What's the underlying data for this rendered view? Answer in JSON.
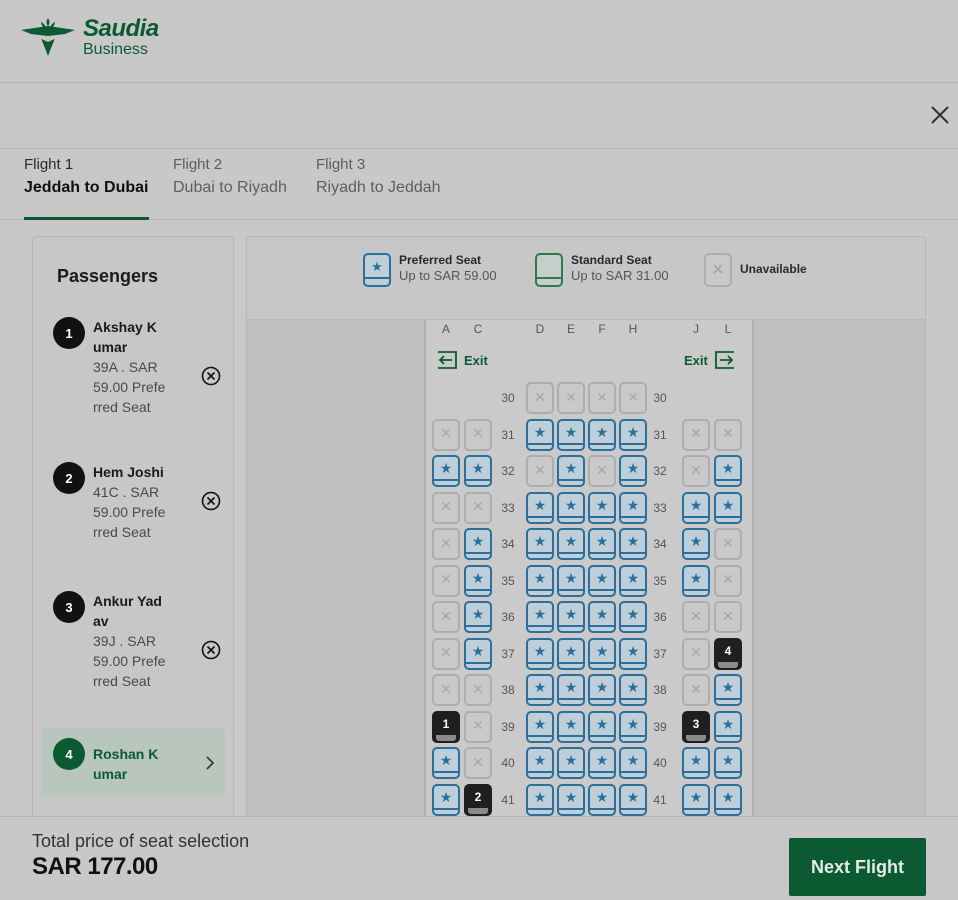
{
  "brand": {
    "name": "Saudia",
    "sub": "Business"
  },
  "tabs": [
    {
      "label": "Flight 1",
      "route": "Jeddah to Dubai",
      "active": true
    },
    {
      "label": "Flight 2",
      "route": "Dubai to Riyadh",
      "active": false
    },
    {
      "label": "Flight 3",
      "route": "Riyadh to Jeddah",
      "active": false
    }
  ],
  "passengers": {
    "title": "Passengers",
    "list": [
      {
        "num": "1",
        "name": "Akshay K umar",
        "info": "39A . SAR 59.00 Preferred Seat"
      },
      {
        "num": "2",
        "name": "Hem Joshi",
        "info": "41C . SAR 59.00 Preferred Seat"
      },
      {
        "num": "3",
        "name": "Ankur Yad av",
        "info": "39J . SAR 59.00 Preferred Seat"
      },
      {
        "num": "4",
        "name": "Roshan K umar",
        "current": true
      }
    ]
  },
  "legend": {
    "preferred": {
      "title": "Preferred Seat",
      "sub": "Up to SAR 59.00"
    },
    "standard": {
      "title": "Standard Seat",
      "sub": "Up to SAR 31.00"
    },
    "unavailable": {
      "title": "Unavailable"
    }
  },
  "seatmap": {
    "columns": [
      "A",
      "C",
      "D",
      "E",
      "F",
      "H",
      "J",
      "L"
    ],
    "exit_left": "Exit",
    "exit_right": "Exit",
    "rows": [
      {
        "num": "30",
        "seats": [
          null,
          null,
          "na",
          "na",
          "na",
          "na",
          null,
          null
        ]
      },
      {
        "num": "31",
        "seats": [
          "na",
          "na",
          "pref",
          "pref",
          "pref",
          "pref",
          "na",
          "na"
        ]
      },
      {
        "num": "32",
        "seats": [
          "pref",
          "pref",
          "na",
          "pref",
          "na",
          "pref",
          "na",
          "pref"
        ]
      },
      {
        "num": "33",
        "seats": [
          "na",
          "na",
          "pref",
          "pref",
          "pref",
          "pref",
          "pref",
          "pref"
        ]
      },
      {
        "num": "34",
        "seats": [
          "na",
          "pref",
          "pref",
          "pref",
          "pref",
          "pref",
          "pref",
          "na"
        ]
      },
      {
        "num": "35",
        "seats": [
          "na",
          "pref",
          "pref",
          "pref",
          "pref",
          "pref",
          "pref",
          "na"
        ]
      },
      {
        "num": "36",
        "seats": [
          "na",
          "pref",
          "pref",
          "pref",
          "pref",
          "pref",
          "na",
          "na"
        ]
      },
      {
        "num": "37",
        "seats": [
          "na",
          "pref",
          "pref",
          "pref",
          "pref",
          "pref",
          "na",
          "4"
        ]
      },
      {
        "num": "38",
        "seats": [
          "na",
          "na",
          "pref",
          "pref",
          "pref",
          "pref",
          "na",
          "pref"
        ]
      },
      {
        "num": "39",
        "seats": [
          "1",
          "na",
          "pref",
          "pref",
          "pref",
          "pref",
          "3",
          "pref"
        ]
      },
      {
        "num": "40",
        "seats": [
          "pref",
          "na",
          "pref",
          "pref",
          "pref",
          "pref",
          "pref",
          "pref"
        ]
      },
      {
        "num": "41",
        "seats": [
          "pref",
          "2",
          "pref",
          "pref",
          "pref",
          "pref",
          "pref",
          "pref"
        ]
      }
    ]
  },
  "footer": {
    "total_label": "Total price of seat selection",
    "total_value": "SAR 177.00",
    "next_label": "Next Flight"
  },
  "colors": {
    "brand_green": "#0c5a32",
    "preferred_blue": "#2b6f9a",
    "overlay_gray": "#c8c8c8"
  },
  "icons": [
    "saudia-logo-icon",
    "close-icon",
    "remove-passenger-icon",
    "chevron-right-icon",
    "star-icon",
    "x-icon",
    "exit-left-icon",
    "exit-right-icon"
  ]
}
